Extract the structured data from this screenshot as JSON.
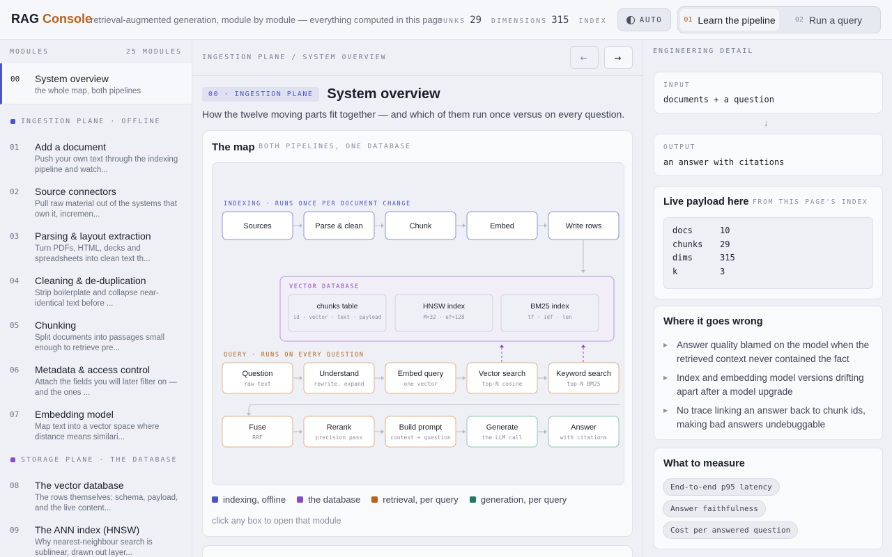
{
  "app": {
    "brand_left": "RAG",
    "brand_right": "Console",
    "tagline": "retrieval-augmented generation, module by module — everything computed in this page"
  },
  "stats": [
    {
      "label": "CHUNKS",
      "value": "29"
    },
    {
      "label": "DIMENSIONS",
      "value": "315"
    },
    {
      "label": "INDEX",
      "value": ""
    }
  ],
  "theme_button": "AUTO",
  "mode_tabs": [
    {
      "num": "01",
      "label": "Learn the pipeline"
    },
    {
      "num": "02",
      "label": "Run a query"
    }
  ],
  "sidebar": {
    "heading": "MODULES",
    "count": "25 MODULES",
    "active": {
      "num": "00",
      "title": "System overview",
      "desc": "the whole map, both pipelines"
    },
    "groups": [
      {
        "label": "INGESTION PLANE · OFFLINE",
        "color": "#4a55c8"
      },
      {
        "label": "STORAGE PLANE · THE DATABASE",
        "color": "#8a4ac0"
      }
    ],
    "items": [
      {
        "num": "01",
        "title": "Add a document",
        "desc": "Push your own text through the indexing pipeline and watch..."
      },
      {
        "num": "02",
        "title": "Source connectors",
        "desc": "Pull raw material out of the systems that own it, incremen..."
      },
      {
        "num": "03",
        "title": "Parsing & layout extraction",
        "desc": "Turn PDFs, HTML, decks and spreadsheets into clean text th..."
      },
      {
        "num": "04",
        "title": "Cleaning & de-duplication",
        "desc": "Strip boilerplate and collapse near-identical text before ..."
      },
      {
        "num": "05",
        "title": "Chunking",
        "desc": "Split documents into passages small enough to retrieve pre..."
      },
      {
        "num": "06",
        "title": "Metadata & access control",
        "desc": "Attach the fields you will later filter on — and the ones ..."
      },
      {
        "num": "07",
        "title": "Embedding model",
        "desc": "Map text into a vector space where distance means similari..."
      },
      {
        "num": "08",
        "title": "The vector database",
        "desc": "The rows themselves: schema, payload, and the live content..."
      },
      {
        "num": "09",
        "title": "The ANN index (HNSW)",
        "desc": "Why nearest-neighbour search is sublinear, drawn out layer..."
      }
    ]
  },
  "main": {
    "breadcrumb": "INGESTION PLANE / SYSTEM OVERVIEW",
    "badge": "00 · INGESTION PLANE",
    "title": "System overview",
    "subtitle": "How the twelve moving parts fit together — and which of them run once versus on every question.",
    "map": {
      "title": "The map",
      "subtitle": "BOTH PIPELINES, ONE DATABASE",
      "indexing_label": "INDEXING · RUNS ONCE PER DOCUMENT CHANGE",
      "db_label": "VECTOR DATABASE",
      "query_label": "QUERY · RUNS ON EVERY QUESTION",
      "indexing_nodes": [
        "Sources",
        "Parse & clean",
        "Chunk",
        "Embed",
        "Write rows"
      ],
      "db_nodes": [
        {
          "title": "chunks table",
          "sub": "id · vector · text · payload"
        },
        {
          "title": "HNSW index",
          "sub": "M=32 · ef=128"
        },
        {
          "title": "BM25 index",
          "sub": "tf · idf · len"
        }
      ],
      "query_nodes": [
        {
          "title": "Question",
          "sub": "raw text"
        },
        {
          "title": "Understand",
          "sub": "rewrite, expand"
        },
        {
          "title": "Embed query",
          "sub": "one vector"
        },
        {
          "title": "Vector search",
          "sub": "top-N cosine"
        },
        {
          "title": "Keyword search",
          "sub": "top-N BM25"
        }
      ],
      "gen_nodes": [
        {
          "title": "Fuse",
          "sub": "RRF",
          "kind": "retrieval"
        },
        {
          "title": "Rerank",
          "sub": "precision pass",
          "kind": "retrieval"
        },
        {
          "title": "Build prompt",
          "sub": "context + question",
          "kind": "retrieval"
        },
        {
          "title": "Generate",
          "sub": "the LLM call",
          "kind": "generation"
        },
        {
          "title": "Answer",
          "sub": "with citations",
          "kind": "generation"
        }
      ],
      "colors": {
        "indexing": "#4a55c8",
        "database": "#8a4ac0",
        "retrieval": "#b6611c",
        "generation": "#1f7a60"
      },
      "legend": [
        {
          "label": "indexing, offline",
          "color": "#4a55c8"
        },
        {
          "label": "the database",
          "color": "#8a4ac0"
        },
        {
          "label": "retrieval, per query",
          "color": "#b6611c"
        },
        {
          "label": "generation, per query",
          "color": "#1f7a60"
        }
      ],
      "hint": "click any box to open that module"
    }
  },
  "detail": {
    "heading": "ENGINEERING DETAIL",
    "input_label": "INPUT",
    "input_value": "documents + a question",
    "output_label": "OUTPUT",
    "output_value": "an answer with citations",
    "payload_title": "Live payload here",
    "payload_sub": "FROM THIS PAGE'S INDEX",
    "payload": [
      {
        "k": "docs",
        "v": "10"
      },
      {
        "k": "chunks",
        "v": "29"
      },
      {
        "k": "dims",
        "v": "315"
      },
      {
        "k": "k",
        "v": "3"
      }
    ],
    "risks_title": "Where it goes wrong",
    "risks": [
      "Answer quality blamed on the model when the retrieved context never contained the fact",
      "Index and embedding model versions drifting apart after a model upgrade",
      "No trace linking an answer back to chunk ids, making bad answers undebuggable"
    ],
    "measure_title": "What to measure",
    "measures": [
      "End-to-end p95 latency",
      "Answer faithfulness",
      "Cost per answered question"
    ]
  }
}
